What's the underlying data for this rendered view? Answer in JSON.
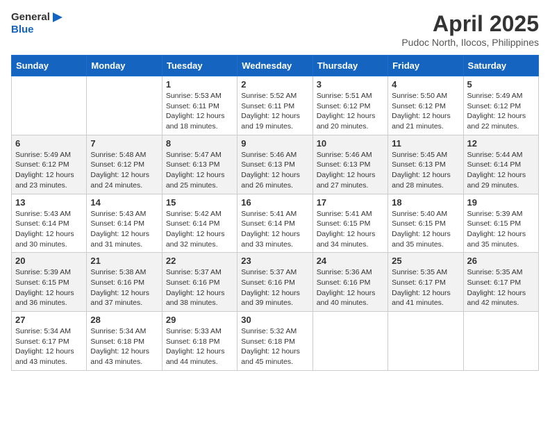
{
  "header": {
    "logo_general": "General",
    "logo_blue": "Blue",
    "title": "April 2025",
    "subtitle": "Pudoc North, Ilocos, Philippines"
  },
  "days_of_week": [
    "Sunday",
    "Monday",
    "Tuesday",
    "Wednesday",
    "Thursday",
    "Friday",
    "Saturday"
  ],
  "weeks": [
    [
      {
        "day": "",
        "info": ""
      },
      {
        "day": "",
        "info": ""
      },
      {
        "day": "1",
        "info": "Sunrise: 5:53 AM\nSunset: 6:11 PM\nDaylight: 12 hours and 18 minutes."
      },
      {
        "day": "2",
        "info": "Sunrise: 5:52 AM\nSunset: 6:11 PM\nDaylight: 12 hours and 19 minutes."
      },
      {
        "day": "3",
        "info": "Sunrise: 5:51 AM\nSunset: 6:12 PM\nDaylight: 12 hours and 20 minutes."
      },
      {
        "day": "4",
        "info": "Sunrise: 5:50 AM\nSunset: 6:12 PM\nDaylight: 12 hours and 21 minutes."
      },
      {
        "day": "5",
        "info": "Sunrise: 5:49 AM\nSunset: 6:12 PM\nDaylight: 12 hours and 22 minutes."
      }
    ],
    [
      {
        "day": "6",
        "info": "Sunrise: 5:49 AM\nSunset: 6:12 PM\nDaylight: 12 hours and 23 minutes."
      },
      {
        "day": "7",
        "info": "Sunrise: 5:48 AM\nSunset: 6:12 PM\nDaylight: 12 hours and 24 minutes."
      },
      {
        "day": "8",
        "info": "Sunrise: 5:47 AM\nSunset: 6:13 PM\nDaylight: 12 hours and 25 minutes."
      },
      {
        "day": "9",
        "info": "Sunrise: 5:46 AM\nSunset: 6:13 PM\nDaylight: 12 hours and 26 minutes."
      },
      {
        "day": "10",
        "info": "Sunrise: 5:46 AM\nSunset: 6:13 PM\nDaylight: 12 hours and 27 minutes."
      },
      {
        "day": "11",
        "info": "Sunrise: 5:45 AM\nSunset: 6:13 PM\nDaylight: 12 hours and 28 minutes."
      },
      {
        "day": "12",
        "info": "Sunrise: 5:44 AM\nSunset: 6:14 PM\nDaylight: 12 hours and 29 minutes."
      }
    ],
    [
      {
        "day": "13",
        "info": "Sunrise: 5:43 AM\nSunset: 6:14 PM\nDaylight: 12 hours and 30 minutes."
      },
      {
        "day": "14",
        "info": "Sunrise: 5:43 AM\nSunset: 6:14 PM\nDaylight: 12 hours and 31 minutes."
      },
      {
        "day": "15",
        "info": "Sunrise: 5:42 AM\nSunset: 6:14 PM\nDaylight: 12 hours and 32 minutes."
      },
      {
        "day": "16",
        "info": "Sunrise: 5:41 AM\nSunset: 6:14 PM\nDaylight: 12 hours and 33 minutes."
      },
      {
        "day": "17",
        "info": "Sunrise: 5:41 AM\nSunset: 6:15 PM\nDaylight: 12 hours and 34 minutes."
      },
      {
        "day": "18",
        "info": "Sunrise: 5:40 AM\nSunset: 6:15 PM\nDaylight: 12 hours and 35 minutes."
      },
      {
        "day": "19",
        "info": "Sunrise: 5:39 AM\nSunset: 6:15 PM\nDaylight: 12 hours and 35 minutes."
      }
    ],
    [
      {
        "day": "20",
        "info": "Sunrise: 5:39 AM\nSunset: 6:15 PM\nDaylight: 12 hours and 36 minutes."
      },
      {
        "day": "21",
        "info": "Sunrise: 5:38 AM\nSunset: 6:16 PM\nDaylight: 12 hours and 37 minutes."
      },
      {
        "day": "22",
        "info": "Sunrise: 5:37 AM\nSunset: 6:16 PM\nDaylight: 12 hours and 38 minutes."
      },
      {
        "day": "23",
        "info": "Sunrise: 5:37 AM\nSunset: 6:16 PM\nDaylight: 12 hours and 39 minutes."
      },
      {
        "day": "24",
        "info": "Sunrise: 5:36 AM\nSunset: 6:16 PM\nDaylight: 12 hours and 40 minutes."
      },
      {
        "day": "25",
        "info": "Sunrise: 5:35 AM\nSunset: 6:17 PM\nDaylight: 12 hours and 41 minutes."
      },
      {
        "day": "26",
        "info": "Sunrise: 5:35 AM\nSunset: 6:17 PM\nDaylight: 12 hours and 42 minutes."
      }
    ],
    [
      {
        "day": "27",
        "info": "Sunrise: 5:34 AM\nSunset: 6:17 PM\nDaylight: 12 hours and 43 minutes."
      },
      {
        "day": "28",
        "info": "Sunrise: 5:34 AM\nSunset: 6:18 PM\nDaylight: 12 hours and 43 minutes."
      },
      {
        "day": "29",
        "info": "Sunrise: 5:33 AM\nSunset: 6:18 PM\nDaylight: 12 hours and 44 minutes."
      },
      {
        "day": "30",
        "info": "Sunrise: 5:32 AM\nSunset: 6:18 PM\nDaylight: 12 hours and 45 minutes."
      },
      {
        "day": "",
        "info": ""
      },
      {
        "day": "",
        "info": ""
      },
      {
        "day": "",
        "info": ""
      }
    ]
  ]
}
